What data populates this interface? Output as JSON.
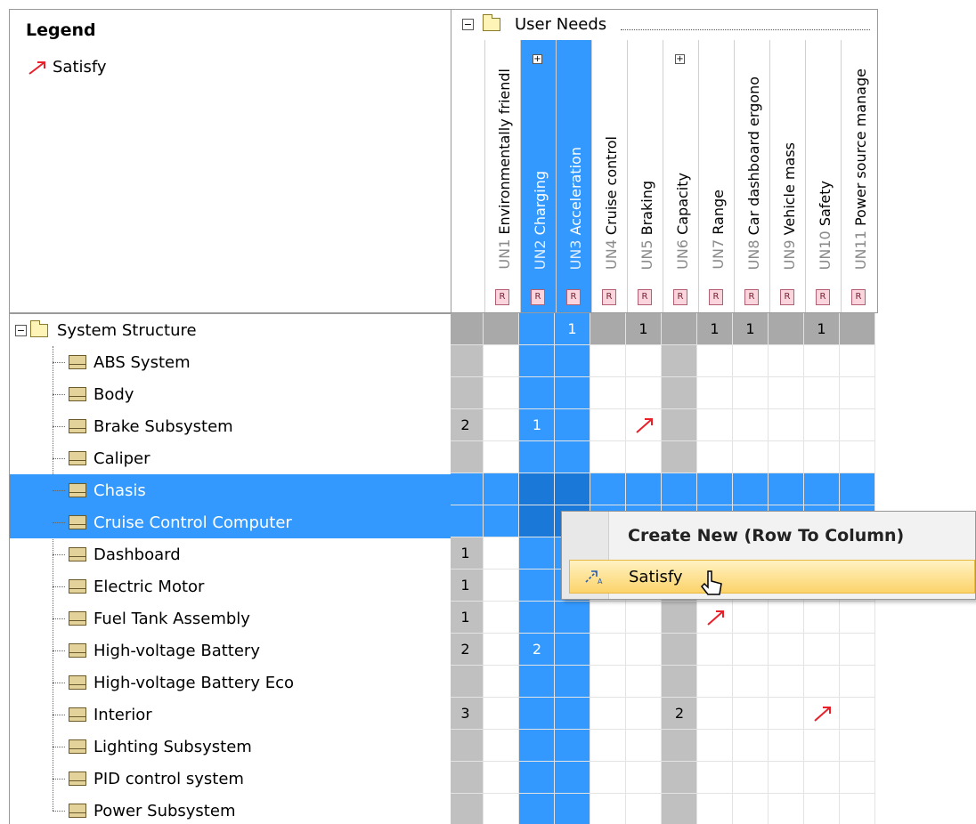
{
  "legend": {
    "title": "Legend",
    "item_label": "Satisfy",
    "item_color": "#e8202a"
  },
  "column_group": {
    "label": "User Needs"
  },
  "columns": [
    {
      "id": "UN1",
      "name": "Environmentally friendl"
    },
    {
      "id": "UN2",
      "name": "Charging",
      "selected": true,
      "expandable": true
    },
    {
      "id": "UN3",
      "name": "Acceleration",
      "selected": true
    },
    {
      "id": "UN4",
      "name": "Cruise control"
    },
    {
      "id": "UN5",
      "name": "Braking"
    },
    {
      "id": "UN6",
      "name": "Capacity",
      "expandable": true
    },
    {
      "id": "UN7",
      "name": "Range"
    },
    {
      "id": "UN8",
      "name": "Car dashboard ergono"
    },
    {
      "id": "UN9",
      "name": "Vehicle mass"
    },
    {
      "id": "UN10",
      "name": "Safety"
    },
    {
      "id": "UN11",
      "name": "Power source manage"
    }
  ],
  "row_group": {
    "label": "System Structure"
  },
  "rows": [
    {
      "name": "ABS System"
    },
    {
      "name": "Body"
    },
    {
      "name": "Brake Subsystem"
    },
    {
      "name": "Caliper"
    },
    {
      "name": "Chasis",
      "selected": true
    },
    {
      "name": "Cruise Control Computer",
      "selected": true
    },
    {
      "name": "Dashboard"
    },
    {
      "name": "Electric Motor"
    },
    {
      "name": "Fuel Tank Assembly"
    },
    {
      "name": "High-voltage Battery"
    },
    {
      "name": "High-voltage Battery Eco"
    },
    {
      "name": "Interior"
    },
    {
      "name": "Lighting Subsystem"
    },
    {
      "name": "PID control system"
    },
    {
      "name": "Power Subsystem"
    }
  ],
  "group_row_counts": [
    "",
    "",
    "",
    "1",
    "",
    "1",
    "",
    "1",
    "1",
    "",
    "1",
    ""
  ],
  "cell_values": [
    {
      "row": 2,
      "col": 0,
      "text": "2"
    },
    {
      "row": 2,
      "col": 2,
      "text": "1"
    },
    {
      "row": 6,
      "col": 0,
      "text": "1"
    },
    {
      "row": 7,
      "col": 0,
      "text": "1"
    },
    {
      "row": 8,
      "col": 0,
      "text": "1"
    },
    {
      "row": 9,
      "col": 0,
      "text": "2"
    },
    {
      "row": 9,
      "col": 2,
      "text": "2"
    },
    {
      "row": 11,
      "col": 0,
      "text": "3"
    },
    {
      "row": 11,
      "col": 6,
      "text": "2"
    }
  ],
  "satisfy_arrows": [
    {
      "row": 2,
      "col": 5
    },
    {
      "row": 8,
      "col": 7
    },
    {
      "row": 11,
      "col": 10
    }
  ],
  "context_menu": {
    "title": "Create New (Row To Column)",
    "item_label": "Satisfy"
  }
}
